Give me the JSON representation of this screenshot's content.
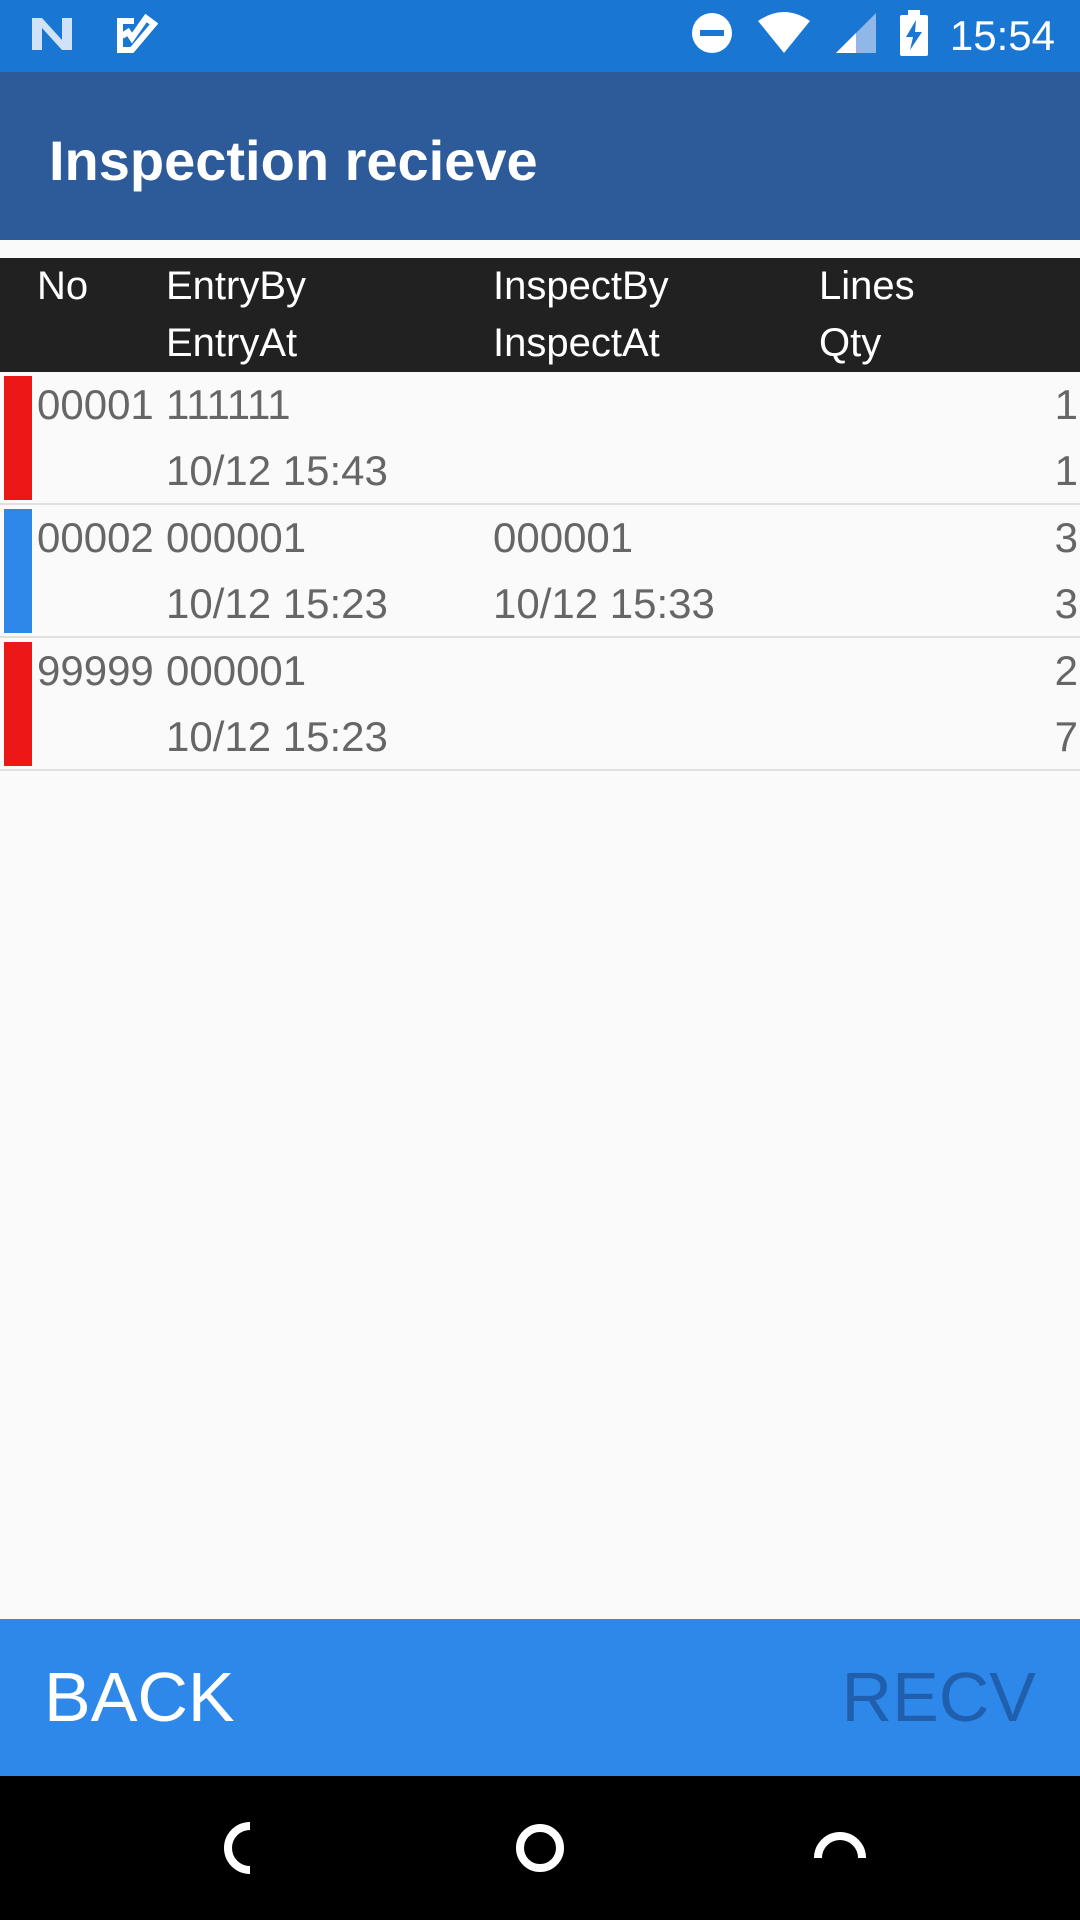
{
  "status_bar": {
    "time": "15:54",
    "icons": [
      "n-logo-icon",
      "check-ticket-icon",
      "dnd-icon",
      "wifi-icon",
      "signal-icon",
      "battery-charging-icon"
    ]
  },
  "app_bar": {
    "title": "Inspection recieve"
  },
  "table": {
    "headers": {
      "no": "No",
      "entry_by": "EntryBy",
      "entry_at": "EntryAt",
      "inspect_by": "InspectBy",
      "inspect_at": "InspectAt",
      "lines": "Lines",
      "qty": "Qty"
    },
    "rows": [
      {
        "no": "00001",
        "entry_by": "111111",
        "entry_at": "10/12 15:43",
        "inspect_by": "",
        "inspect_at": "",
        "lines": "1",
        "qty": "1",
        "status_color": "#ee1717"
      },
      {
        "no": "00002",
        "entry_by": "000001",
        "entry_at": "10/12 15:23",
        "inspect_by": "000001",
        "inspect_at": "10/12 15:33",
        "lines": "3",
        "qty": "3",
        "status_color": "#2e88ea"
      },
      {
        "no": "99999",
        "entry_by": "000001",
        "entry_at": "10/12 15:23",
        "inspect_by": "",
        "inspect_at": "",
        "lines": "2",
        "qty": "7",
        "status_color": "#ee1717"
      }
    ]
  },
  "bottom_bar": {
    "back_label": "BACK",
    "recv_label": "RECV"
  },
  "colors": {
    "status_bar": "#1976d2",
    "app_bar": "#2d5a99",
    "bottom_bar": "#2e88ea",
    "header_bg": "#212121"
  }
}
